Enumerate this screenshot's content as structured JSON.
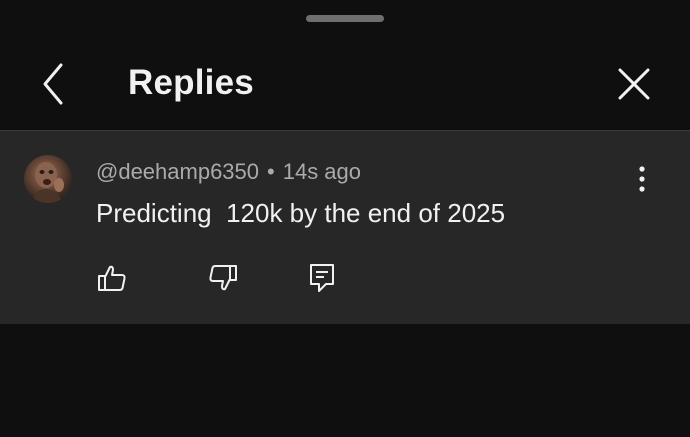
{
  "header": {
    "title": "Replies",
    "back_icon": "chevron-left-icon",
    "close_icon": "close-icon"
  },
  "comment": {
    "author": "@deehamp6350",
    "separator": "•",
    "time": "14s ago",
    "text": "Predicting  120k by the end of 2025",
    "actions": {
      "like_icon": "thumbs-up-icon",
      "dislike_icon": "thumbs-down-icon",
      "reply_icon": "reply-comment-icon",
      "more_icon": "more-vertical-icon"
    }
  },
  "colors": {
    "background": "#0f0f0f",
    "comment_background": "#272727",
    "primary_text": "#f1f1f1",
    "secondary_text": "#aaaaaa"
  }
}
